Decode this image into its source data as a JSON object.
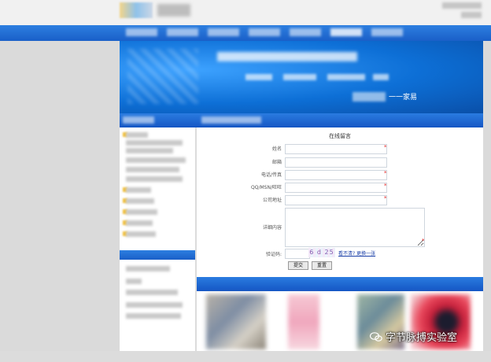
{
  "form": {
    "title": "在线留言",
    "fields": [
      {
        "label": "姓名",
        "required": true
      },
      {
        "label": "邮箱",
        "required": false
      },
      {
        "label": "电话/传真",
        "required": true
      },
      {
        "label": "QQ/MSN/旺旺",
        "required": true
      },
      {
        "label": "公司地址",
        "required": true
      }
    ],
    "content_label": "详细内容",
    "captcha_label": "验证码:",
    "captcha_text": "6 d 25",
    "captcha_link": "看不清? 更换一张",
    "submit_label": "提交",
    "reset_label": "重置"
  },
  "banner": {
    "slogan": "一一家易"
  },
  "watermark": {
    "text": "字节脉搏实验室"
  },
  "colors": {
    "nav_blue": "#1a5fc8",
    "banner_blue": "#0d6fd6",
    "required": "#e02020"
  }
}
